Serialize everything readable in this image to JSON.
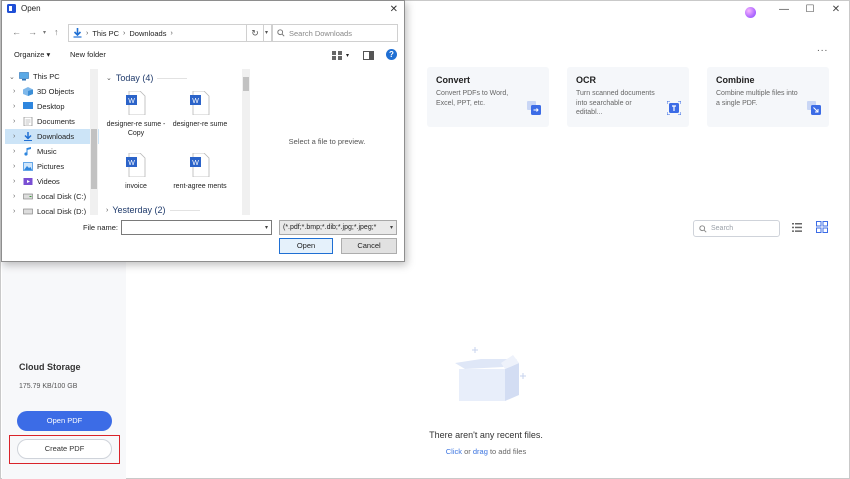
{
  "app": {
    "window_controls": {
      "minimize": "—",
      "maximize": "☐",
      "close": "✕"
    },
    "more": "...",
    "features": [
      {
        "title": "Convert",
        "desc": "Convert PDFs to Word, Excel, PPT, etc."
      },
      {
        "title": "OCR",
        "desc": "Turn scanned documents into searchable or editabl..."
      },
      {
        "title": "Combine",
        "desc": "Combine multiple files into a single PDF."
      }
    ],
    "search_placeholder": "Search",
    "empty_title": "There aren't any recent files.",
    "empty_sub": {
      "click": "Click",
      "or": " or ",
      "drag": "drag",
      "rest": " to add files"
    },
    "cloud": {
      "title": "Cloud Storage",
      "usage": "175.79 KB/100 GB"
    },
    "buttons": {
      "open_pdf": "Open PDF",
      "create_pdf": "Create PDF"
    },
    "colors": {
      "accent": "#3c6ce6",
      "highlight": "#d9232a"
    }
  },
  "dialog": {
    "title": "Open",
    "close": "✕",
    "address": {
      "root": "This PC",
      "folder": "Downloads"
    },
    "search_placeholder": "Search Downloads",
    "toolbar": {
      "organize": "Organize ▾",
      "new_folder": "New folder"
    },
    "nav_items": [
      {
        "label": "This PC",
        "icon": "pc-icon"
      },
      {
        "label": "3D Objects",
        "icon": "cube-icon"
      },
      {
        "label": "Desktop",
        "icon": "desktop-icon"
      },
      {
        "label": "Documents",
        "icon": "documents-icon"
      },
      {
        "label": "Downloads",
        "icon": "download-icon"
      },
      {
        "label": "Music",
        "icon": "music-icon"
      },
      {
        "label": "Pictures",
        "icon": "pictures-icon"
      },
      {
        "label": "Videos",
        "icon": "videos-icon"
      },
      {
        "label": "Local Disk (C:)",
        "icon": "disk-icon"
      },
      {
        "label": "Local Disk (D:)",
        "icon": "disk-icon"
      }
    ],
    "groups": [
      {
        "label": "Today (4)"
      },
      {
        "label": "Yesterday (2)"
      }
    ],
    "files": [
      {
        "name": "designer-re sume - Copy"
      },
      {
        "name": "designer-re sume"
      },
      {
        "name": "invoice"
      },
      {
        "name": "rent-agree ments"
      }
    ],
    "preview_text": "Select a file to preview.",
    "file_name_label": "File name:",
    "file_name_value": "",
    "filter": "(*.pdf;*.bmp;*.dib;*.jpg;*.jpeg;*",
    "open_button": "Open",
    "cancel_button": "Cancel"
  }
}
